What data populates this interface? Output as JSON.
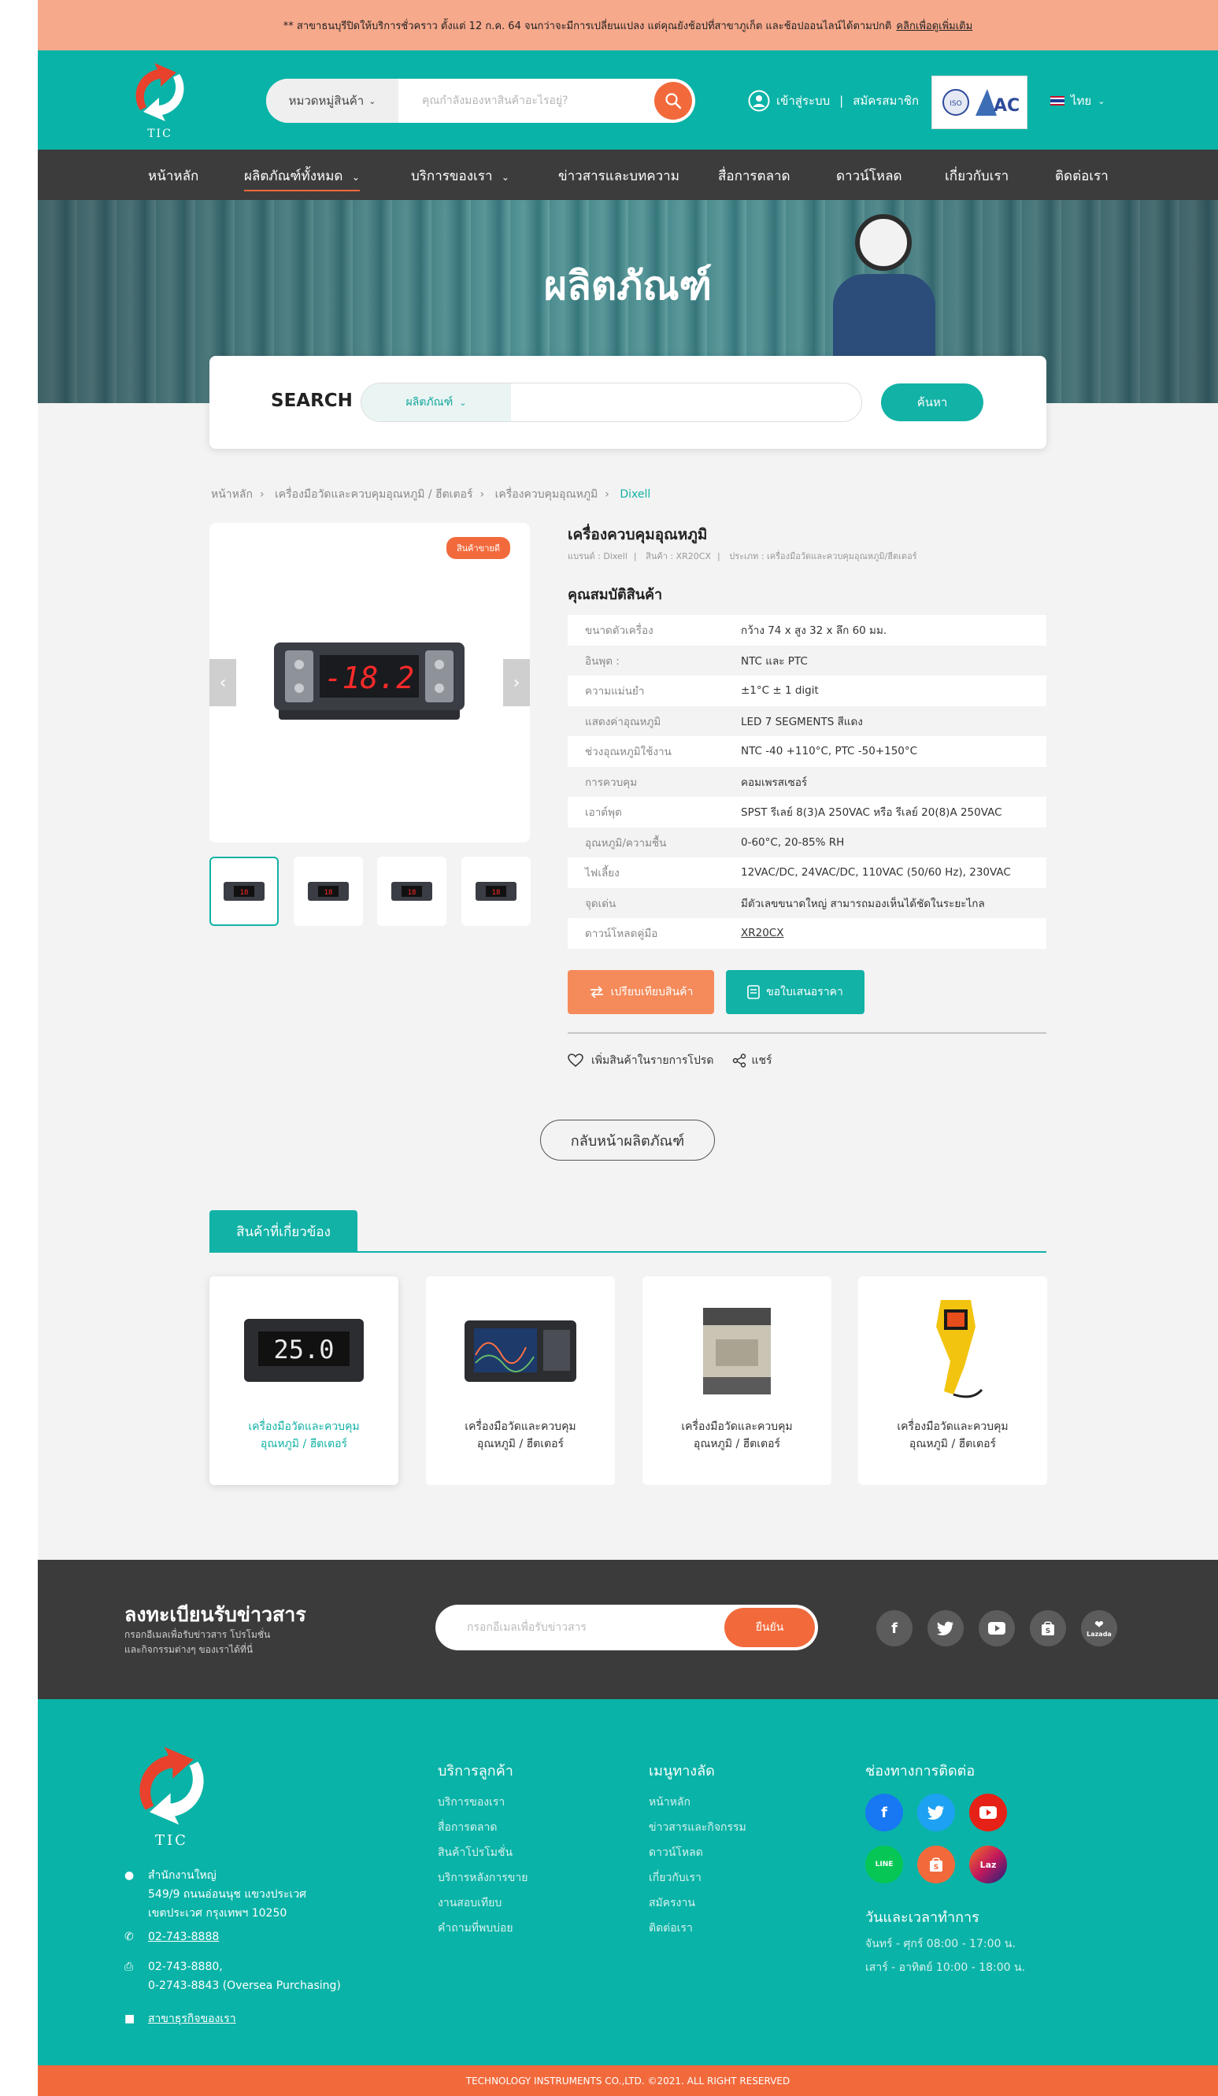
{
  "announcement": {
    "text": "** สาขาธนบุรีปิดให้บริการชั่วคราว ตั้งแต่ 12 ก.ค. 64 จนกว่าจะมีการเปลี่ยนแปลง แต่คุณยังช้อปที่สาขาภูเก็ต และช้อปออนไลน์ได้ตามปกติ",
    "link": "คลิกเพื่อดูเพิ่มเติม"
  },
  "header": {
    "logo_text": "TIC",
    "category_button": "หมวดหมู่สินค้า",
    "search_placeholder": "คุณกำลังมองหาสินค้าอะไรอยู่?",
    "login": "เข้าสู่ระบบ",
    "register": "สมัครสมาชิก",
    "language": "ไทย"
  },
  "nav": [
    "หน้าหลัก",
    "ผลิตภัณฑ์ทั้งหมด",
    "บริการของเรา",
    "ข่าวสารและบทความ",
    "สื่อการตลาด",
    "ดาวน์โหลด",
    "เกี่ยวกับเรา",
    "ติดต่อเรา"
  ],
  "hero": {
    "title": "ผลิตภัณฑ์"
  },
  "search": {
    "label": "SEARCH",
    "category": "ผลิตภัณฑ์",
    "button": "ค้นหา"
  },
  "breadcrumb": [
    "หน้าหลัก",
    "เครื่องมือวัดและควบคุมอุณหภูมิ / ฮีตเตอร์",
    "เครื่องควบคุมอุณหภูมิ",
    "Dixell"
  ],
  "product": {
    "badge": "สินค้าขายดี",
    "title": "เครื่องควบคุมอุณหภูมิ",
    "brand": "แบรนด์ : Dixell",
    "sku": "สินค้า : XR20CX",
    "type": "ประเภท : เครื่องมือวัดและควบคุมอุณหภูมิ/ฮีตเตอร์",
    "spec_heading": "คุณสมบัติสินค้า",
    "display_value": "-18.2",
    "specs": [
      {
        "k": "ขนาดตัวเครื่อง",
        "v": "กว้าง 74 x สูง 32 x ลึก 60 มม."
      },
      {
        "k": "อินพุต :",
        "v": "NTC และ PTC"
      },
      {
        "k": "ความแม่นยำ",
        "v": "±1°C ± 1 digit"
      },
      {
        "k": "แสดงค่าอุณหภูมิ",
        "v": "LED 7 SEGMENTS สีแดง"
      },
      {
        "k": "ช่วงอุณหภูมิใช้งาน",
        "v": "NTC -40 +110°C, PTC -50+150°C"
      },
      {
        "k": "การควบคุม",
        "v": "คอมเพรสเซอร์"
      },
      {
        "k": "เอาต์พุต",
        "v": "SPST รีเลย์ 8(3)A 250VAC หรือ รีเลย์ 20(8)A 250VAC"
      },
      {
        "k": "อุณหภูมิ/ความชื้น",
        "v": "0-60°C, 20-85% RH"
      },
      {
        "k": "ไฟเลี้ยง",
        "v": "12VAC/DC, 24VAC/DC, 110VAC (50/60 Hz), 230VAC"
      },
      {
        "k": "จุดเด่น",
        "v": "มีตัวเลขขนาดใหญ่ สามารถมองเห็นได้ชัดในระยะไกล"
      },
      {
        "k": "ดาวน์โหลดคู่มือ",
        "v": "XR20CX"
      }
    ],
    "compare_btn": "เปรียบเทียบสินค้า",
    "quote_btn": "ขอใบเสนอราคา",
    "wishlist": "เพิ่มสินค้าในรายการโปรด",
    "share": "แชร์"
  },
  "back_button": "กลับหน้าผลิตภัณฑ์",
  "related": {
    "title": "สินค้าที่เกี่ยวข้อง",
    "items": [
      {
        "line1": "เครื่องมือวัดและควบคุม",
        "line2": "อุณหภูมิ / ฮีตเตอร์"
      },
      {
        "line1": "เครื่องมือวัดและควบคุม",
        "line2": "อุณหภูมิ / ฮีตเตอร์"
      },
      {
        "line1": "เครื่องมือวัดและควบคุม",
        "line2": "อุณหภูมิ / ฮีตเตอร์"
      },
      {
        "line1": "เครื่องมือวัดและควบคุม",
        "line2": "อุณหภูมิ / ฮีตเตอร์"
      }
    ],
    "display_value": "25.0"
  },
  "newsletter": {
    "title": "ลงทะเบียนรับข่าวสาร",
    "sub1": "กรอกอีเมลเพื่อรับข่าวสาร โปรโมชั่น",
    "sub2": "และกิจกรรมต่างๆ ของเราได้ที่นี่",
    "placeholder": "กรอกอีเมลเพื่อรับข่าวสาร",
    "button": "ยืนยัน",
    "lazada_label": "Lazada"
  },
  "footer": {
    "logo_text": "TIC",
    "address_title": "สำนักงานใหญ่",
    "address1": "549/9 ถนนอ่อนนุช แขวงประเวศ",
    "address2": "เขตประเวศ กรุงเทพฯ 10250",
    "phone": "02-743-8888",
    "fax1": "02-743-8880,",
    "fax2": "0-2743-8843 (Oversea Purchasing)",
    "branches": "สาขาธุรกิจของเรา",
    "services_title": "บริการลูกค้า",
    "services": [
      "บริการของเรา",
      "สื่อการตลาด",
      "สินค้าโปรโมชั่น",
      "บริการหลังการขาย",
      "งานสอบเทียบ",
      "คำถามที่พบบ่อย"
    ],
    "menu_title": "เมนูทางลัด",
    "menu": [
      "หน้าหลัก",
      "ข่าวสารและกิจกรรม",
      "ดาวน์โหลด",
      "เกี่ยวกับเรา",
      "สมัครงาน",
      "ติดต่อเรา"
    ],
    "contact_title": "ช่องทางการติดต่อ",
    "hours_title": "วันและเวลาทำการ",
    "hours1": "จันทร์ - ศุกร์ 08:00 - 17:00 น.",
    "hours2": "เสาร์ - อาทิตย์ 10:00 - 18:00 น.",
    "line_label": "LINE",
    "lazada_label": "Laz"
  },
  "copyright": "TECHNOLOGY INSTRUMENTS CO.,LTD. ©2021. ALL RIGHT RESERVED",
  "colors": {
    "teal": "#0ab3a7",
    "orange": "#f26a3c",
    "dark": "#3c3c3c",
    "announce": "#f7a98c"
  }
}
